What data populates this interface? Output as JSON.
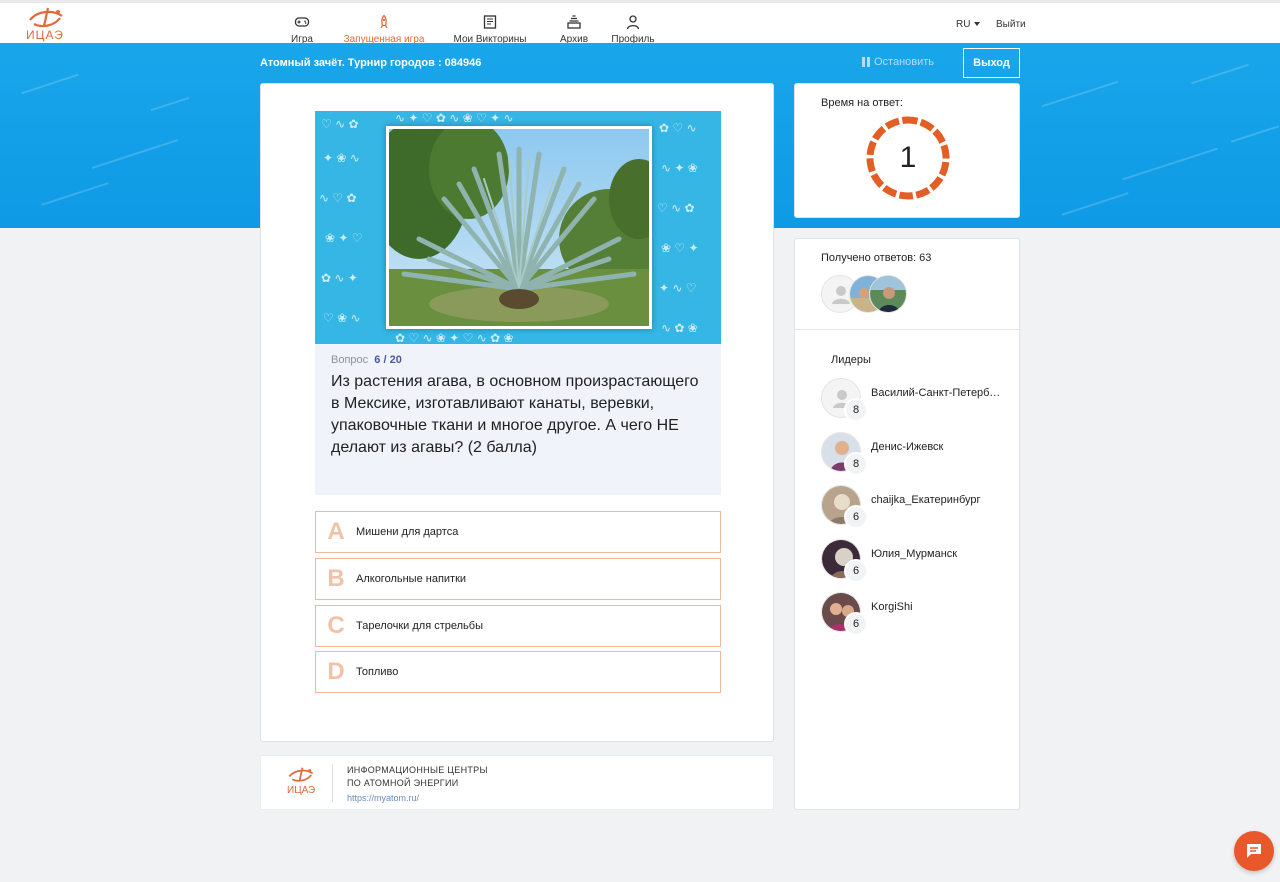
{
  "brand": {
    "logo_text": "ИЦАЭ",
    "accent": "#e06a3a",
    "band_color": "#0e9ae5"
  },
  "nav": {
    "items": [
      {
        "label": "Игра",
        "icon": "gamepad-icon"
      },
      {
        "label": "Запущенная игра",
        "icon": "rocket-icon",
        "active": true
      },
      {
        "label": "Мои Викторины",
        "icon": "book-icon"
      },
      {
        "label": "Архив",
        "icon": "archive-icon"
      },
      {
        "label": "Профиль",
        "icon": "user-icon"
      }
    ],
    "lang": "RU",
    "logout": "Выйти"
  },
  "game": {
    "title": "Атомный зачёт. Турнир городов : 084946",
    "stop_label": "Остановить",
    "exit_label": "Выход"
  },
  "question": {
    "label": "Вопрос",
    "number": "6",
    "total": "/ 20",
    "text": "Из растения агава, в основном произрастающего в Мексике, изготавливают канаты, веревки, упаковочные ткани и многое другое. А чего НЕ делают из агавы? (2 балла)",
    "answers": [
      {
        "letter": "A",
        "text": "Мишени для дартса"
      },
      {
        "letter": "B",
        "text": "Алкогольные напитки"
      },
      {
        "letter": "C",
        "text": "Тарелочки для стрельбы"
      },
      {
        "letter": "D",
        "text": "Топливо"
      }
    ]
  },
  "timer": {
    "label": "Время на ответ:",
    "value": "1"
  },
  "responses": {
    "label": "Получено ответов: 63"
  },
  "leaders": {
    "title": "Лидеры",
    "items": [
      {
        "name": "Василий-Санкт-Петербург",
        "score": "8"
      },
      {
        "name": "Денис-Ижевск",
        "score": "8"
      },
      {
        "name": "chaijka_Екатеринбург",
        "score": "6"
      },
      {
        "name": "Юлия_Мурманск",
        "score": "6"
      },
      {
        "name": "KorgiShi",
        "score": "6"
      }
    ]
  },
  "footer": {
    "line1": "ИНФОРМАЦИОННЫЕ ЦЕНТРЫ",
    "line2": "ПО АТОМНОЙ ЭНЕРГИИ",
    "link": "https://myatom.ru/"
  }
}
